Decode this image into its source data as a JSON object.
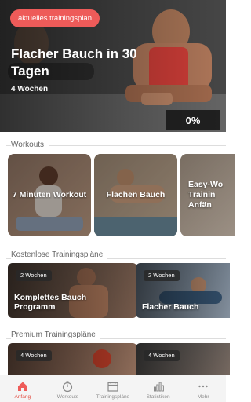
{
  "hero": {
    "current_plan_label": "aktuelles trainingsplan",
    "title": "Flacher Bauch in 30 Tagen",
    "weeks": "4 Wochen",
    "progress": "0%"
  },
  "sections": {
    "workouts": "Workouts",
    "free_plans": "Kostenlose Trainingspläne",
    "premium_plans": "Premium Trainingspläne"
  },
  "workouts": [
    {
      "label": "7 Minuten Workout"
    },
    {
      "label": "Flachen Bauch"
    },
    {
      "label": "Easy-Wo Trainin Anfän"
    }
  ],
  "free_plans": [
    {
      "badge": "2 Wochen",
      "label": "Komplettes Bauch Programm"
    },
    {
      "badge": "2 Wochen",
      "label": "Flacher Bauch"
    }
  ],
  "premium_plans": [
    {
      "badge": "4 Wochen",
      "label": ""
    },
    {
      "badge": "4 Wochen",
      "label": ""
    }
  ],
  "nav": [
    {
      "label": "Anfang",
      "icon": "home-icon",
      "active": true
    },
    {
      "label": "Workouts",
      "icon": "stopwatch-icon",
      "active": false
    },
    {
      "label": "Trainingspläne",
      "icon": "calendar-icon",
      "active": false
    },
    {
      "label": "Statistiken",
      "icon": "bar-chart-icon",
      "active": false
    },
    {
      "label": "Mehr",
      "icon": "more-dots-icon",
      "active": false
    }
  ],
  "colors": {
    "accent": "#ee5b59",
    "nav_active": "#e24a3f"
  }
}
